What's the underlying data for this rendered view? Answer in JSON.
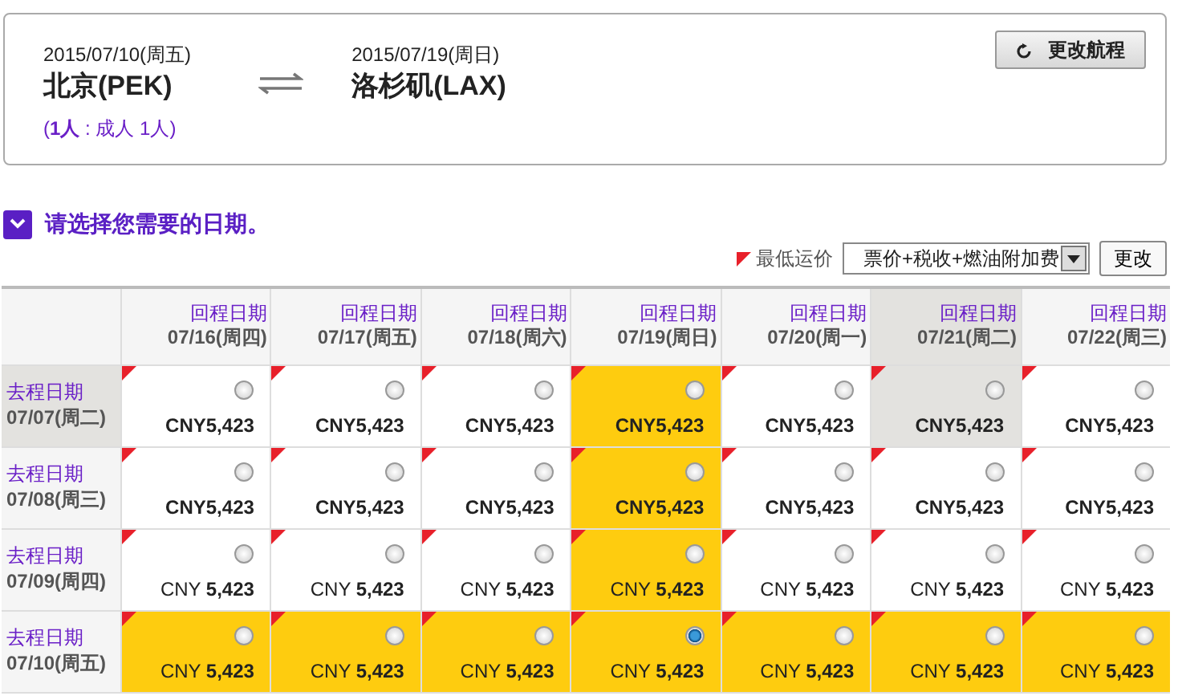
{
  "itinerary": {
    "outbound": {
      "date": "2015/07/10(周五)",
      "city": "北京(PEK)"
    },
    "inbound": {
      "date": "2015/07/19(周日)",
      "city": "洛杉矶(LAX)"
    },
    "passengers": "(**1人** : 成人 1人)",
    "change_button": "更改航程"
  },
  "section_title": "请选择您需要的日期。",
  "legend": "最低运价",
  "fare_select": "票价+税收+燃油附加费",
  "update_button": "更改",
  "columns": [
    {
      "label": "回程日期",
      "date": "07/16(周四)",
      "current": false
    },
    {
      "label": "回程日期",
      "date": "07/17(周五)",
      "current": false
    },
    {
      "label": "回程日期",
      "date": "07/18(周六)",
      "current": false
    },
    {
      "label": "回程日期",
      "date": "07/19(周日)",
      "current": false
    },
    {
      "label": "回程日期",
      "date": "07/20(周一)",
      "current": false
    },
    {
      "label": "回程日期",
      "date": "07/21(周二)",
      "current": true
    },
    {
      "label": "回程日期",
      "date": "07/22(周三)",
      "current": false
    }
  ],
  "rows": [
    {
      "label": "去程日期",
      "date": "07/07(周二)",
      "current": true,
      "bold_price": true,
      "cells": [
        {
          "price": "CNY5,423",
          "highlighted": false,
          "selected": false
        },
        {
          "price": "CNY5,423",
          "highlighted": false,
          "selected": false
        },
        {
          "price": "CNY5,423",
          "highlighted": false,
          "selected": false
        },
        {
          "price": "CNY5,423",
          "highlighted": true,
          "selected": false
        },
        {
          "price": "CNY5,423",
          "highlighted": false,
          "selected": false
        },
        {
          "price": "CNY5,423",
          "highlighted": false,
          "selected": false
        },
        {
          "price": "CNY5,423",
          "highlighted": false,
          "selected": false
        }
      ]
    },
    {
      "label": "去程日期",
      "date": "07/08(周三)",
      "current": false,
      "bold_price": true,
      "cells": [
        {
          "price": "CNY5,423",
          "highlighted": false,
          "selected": false
        },
        {
          "price": "CNY5,423",
          "highlighted": false,
          "selected": false
        },
        {
          "price": "CNY5,423",
          "highlighted": false,
          "selected": false
        },
        {
          "price": "CNY5,423",
          "highlighted": true,
          "selected": false
        },
        {
          "price": "CNY5,423",
          "highlighted": false,
          "selected": false
        },
        {
          "price": "CNY5,423",
          "highlighted": false,
          "selected": false
        },
        {
          "price": "CNY5,423",
          "highlighted": false,
          "selected": false
        }
      ]
    },
    {
      "label": "去程日期",
      "date": "07/09(周四)",
      "current": false,
      "bold_price": false,
      "cells": [
        {
          "price": "CNY **5,423**",
          "highlighted": false,
          "selected": false
        },
        {
          "price": "CNY **5,423**",
          "highlighted": false,
          "selected": false
        },
        {
          "price": "CNY **5,423**",
          "highlighted": false,
          "selected": false
        },
        {
          "price": "CNY **5,423**",
          "highlighted": true,
          "selected": false
        },
        {
          "price": "CNY **5,423**",
          "highlighted": false,
          "selected": false
        },
        {
          "price": "CNY **5,423**",
          "highlighted": false,
          "selected": false
        },
        {
          "price": "CNY **5,423**",
          "highlighted": false,
          "selected": false
        }
      ]
    },
    {
      "label": "去程日期",
      "date": "07/10(周五)",
      "current": false,
      "bold_price": false,
      "cells": [
        {
          "price": "CNY **5,423**",
          "highlighted": true,
          "selected": false
        },
        {
          "price": "CNY **5,423**",
          "highlighted": true,
          "selected": false
        },
        {
          "price": "CNY **5,423**",
          "highlighted": true,
          "selected": false
        },
        {
          "price": "CNY **5,423**",
          "highlighted": true,
          "selected": true
        },
        {
          "price": "CNY **5,423**",
          "highlighted": true,
          "selected": false
        },
        {
          "price": "CNY **5,423**",
          "highlighted": true,
          "selected": false
        },
        {
          "price": "CNY **5,423**",
          "highlighted": true,
          "selected": false
        }
      ]
    }
  ]
}
